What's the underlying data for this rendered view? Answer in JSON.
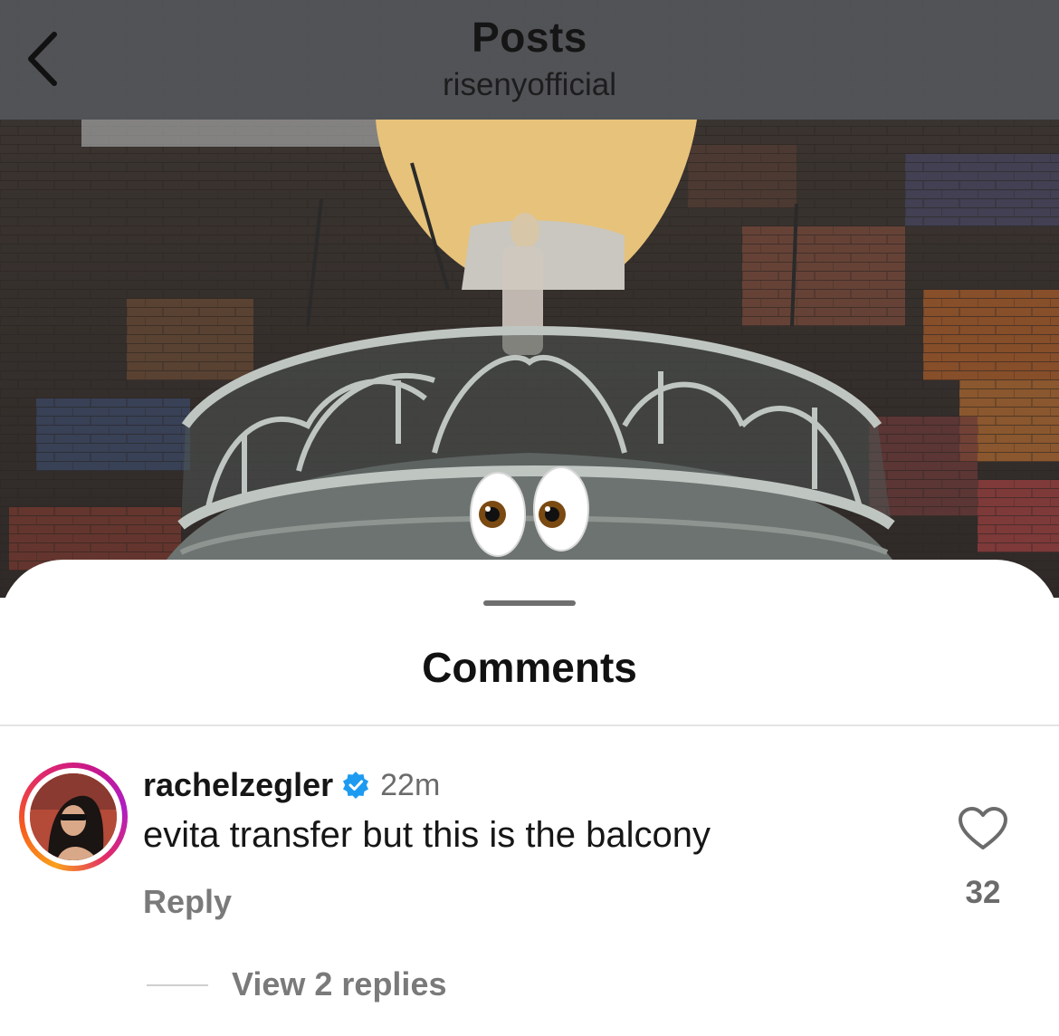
{
  "header": {
    "title": "Posts",
    "subtitle": "risenyofficial",
    "back_icon": "chevron-left-icon"
  },
  "sheet": {
    "title": "Comments"
  },
  "comment": {
    "username": "rachelzegler",
    "verified": true,
    "time": "22m",
    "text": "evita transfer but this is the balcony",
    "reply_label": "Reply",
    "like_count": "32",
    "view_replies_label": "View 2 replies"
  },
  "colors": {
    "topbar": "#525458",
    "verified": "#1d9bf0",
    "muted_text": "#7a7a7a"
  }
}
